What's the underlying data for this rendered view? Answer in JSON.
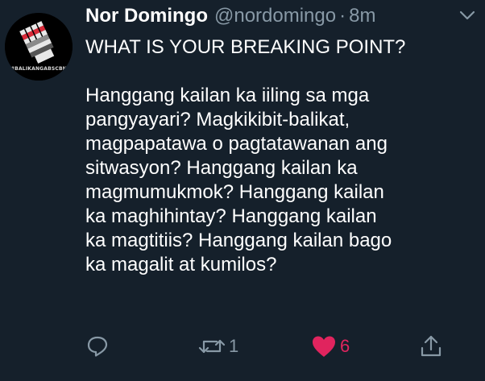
{
  "tweet": {
    "display_name": "Nor Domingo",
    "handle": "@nordomingo",
    "separator": "·",
    "time": "8m",
    "avatar_caption": "#BALIKANGABSCBN",
    "headline": "WHAT IS YOUR BREAKING POINT?",
    "body_lines": [
      "Hanggang kailan ka iiling sa mga",
      "pangyayari? Magkikibit-balikat,",
      "magpapatawa o pagtatawanan ang",
      "sitwasyon? Hanggang kailan ka",
      "magmumukmok? Hanggang kailan",
      "ka maghihintay? Hanggang kailan",
      "ka magtitiis? Hanggang kailan bago",
      "ka magalit at kumilos?"
    ]
  },
  "actions": {
    "reply_icon": "reply-icon",
    "retweet_icon": "retweet-icon",
    "retweet_count": "1",
    "like_icon": "heart-icon",
    "like_count": "6",
    "share_icon": "share-icon"
  },
  "colors": {
    "background": "#15202b",
    "text": "#ffffff",
    "secondary": "#8899a6",
    "like": "#e0245e"
  }
}
